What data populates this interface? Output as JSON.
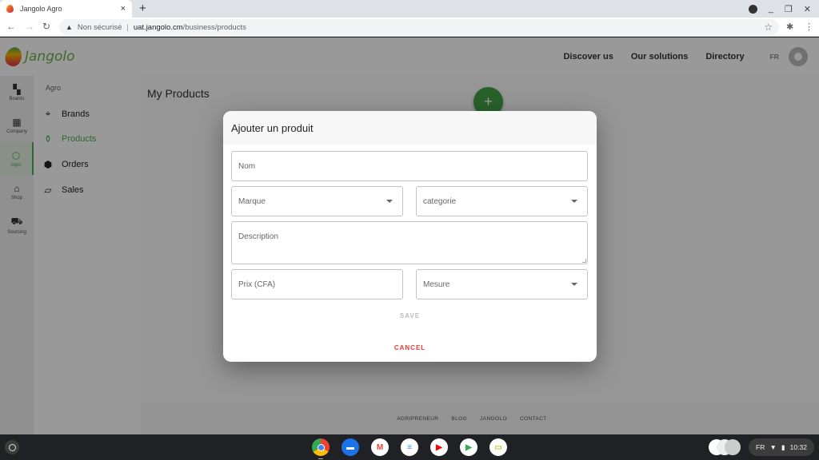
{
  "browser": {
    "tab_title": "Jangolo Agro",
    "tab_close": "×",
    "new_tab": "+",
    "security_label": "Non sécurisé",
    "url_host": "uat.jangolo.cm",
    "url_path": "/business/products",
    "back": "←",
    "forward": "→",
    "reload": "↻",
    "bookmark": "☆",
    "extensions": "✱",
    "menu": "⋮",
    "minimize": "_",
    "restore": "❐",
    "close": "✕"
  },
  "appbar": {
    "logo_text": "Jangolo",
    "nav": [
      "Discover us",
      "Our solutions",
      "Directory"
    ],
    "lang": "FR"
  },
  "rail": {
    "items": [
      {
        "label": "Boards",
        "icon": "▚"
      },
      {
        "label": "Company",
        "icon": "▦"
      },
      {
        "label": "Agro",
        "icon": "⬡",
        "active": true
      },
      {
        "label": "Shop",
        "icon": "⌂"
      },
      {
        "label": "Sourcing",
        "icon": "⛟"
      }
    ]
  },
  "subnav": {
    "header": "Agro",
    "items": [
      {
        "label": "Brands",
        "icon": "⌖"
      },
      {
        "label": "Products",
        "icon": "⚱",
        "active": true
      },
      {
        "label": "Orders",
        "icon": "⬢"
      },
      {
        "label": "Sales",
        "icon": "▱"
      }
    ]
  },
  "content": {
    "page_title": "My Products",
    "fab_label": "+"
  },
  "dialog": {
    "title": "Ajouter un produit",
    "fields": {
      "nom": {
        "placeholder": "Nom",
        "value": ""
      },
      "marque": {
        "placeholder": "Marque",
        "value": ""
      },
      "categorie": {
        "placeholder": "categorie",
        "value": ""
      },
      "description": {
        "placeholder": "Description",
        "value": ""
      },
      "prix": {
        "placeholder": "Prix (CFA)",
        "value": ""
      },
      "mesure": {
        "placeholder": "Mesure",
        "value": ""
      }
    },
    "save_label": "SAVE",
    "cancel_label": "CANCEL"
  },
  "footer": {
    "links": [
      "AGRIPRENEUR",
      "BLOG",
      "JANGOLO",
      "CONTACT"
    ]
  },
  "shelf": {
    "apps": [
      {
        "name": "chrome",
        "color": "#4285f4",
        "glyph": "◉"
      },
      {
        "name": "files",
        "color": "#1a73e8",
        "glyph": "▬"
      },
      {
        "name": "gmail",
        "color": "#ffffff",
        "glyph": "M"
      },
      {
        "name": "docs",
        "color": "#4285f4",
        "glyph": "≡"
      },
      {
        "name": "youtube",
        "color": "#ff0000",
        "glyph": "▶"
      },
      {
        "name": "play-store",
        "color": "#ffffff",
        "glyph": "▶"
      },
      {
        "name": "keep",
        "color": "#fbbc04",
        "glyph": "▭"
      }
    ],
    "ime": "FR",
    "time": "10:32"
  },
  "colors": {
    "brand_green": "#4caf50",
    "fab_green": "#43a047",
    "cancel_red": "#e53935"
  }
}
